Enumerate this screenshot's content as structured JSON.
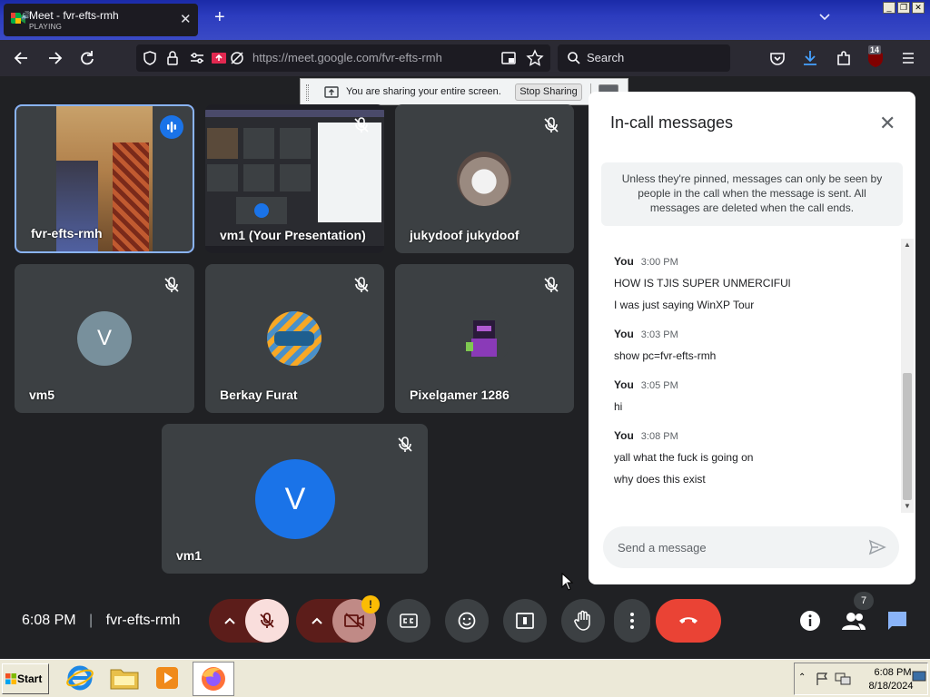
{
  "browser": {
    "tab_title": "Meet - fvr-efts-rmh",
    "tab_subtitle": "PLAYING",
    "url": "https://meet.google.com/fvr-efts-rmh",
    "search_placeholder": "Search",
    "extension_badge": "14"
  },
  "share_banner": {
    "text": "You are sharing your entire screen.",
    "stop_label": "Stop Sharing"
  },
  "participants": [
    {
      "name": "fvr-efts-rmh"
    },
    {
      "name": "vm1 (Your Presentation)"
    },
    {
      "name": "jukydoof jukydoof"
    },
    {
      "name": "vm5",
      "initial": "V"
    },
    {
      "name": "Berkay Furat"
    },
    {
      "name": "Pixelgamer 1286"
    },
    {
      "name": "vm1",
      "initial": "V"
    }
  ],
  "chat": {
    "title": "In-call messages",
    "notice": "Unless they're pinned, messages can only be seen by people in the call when the message is sent. All messages are deleted when the call ends.",
    "messages": [
      {
        "sender": "You",
        "time": "3:00 PM",
        "lines": [
          "HOW IS TJIS SUPER UNMERCIFUl",
          "I was just saying WinXP Tour"
        ]
      },
      {
        "sender": "You",
        "time": "3:03 PM",
        "lines": [
          "show pc=fvr-efts-rmh"
        ]
      },
      {
        "sender": "You",
        "time": "3:05 PM",
        "lines": [
          "hi"
        ]
      },
      {
        "sender": "You",
        "time": "3:08 PM",
        "lines": [
          "yall what the fuck is going on",
          "why does this exist"
        ]
      }
    ],
    "input_placeholder": "Send a message"
  },
  "meeting": {
    "time": "6:08 PM",
    "code": "fvr-efts-rmh",
    "participant_count": "7",
    "camera_warning": "!"
  },
  "taskbar": {
    "start_label": "Start",
    "time": "6:08 PM",
    "date": "8/18/2024"
  },
  "colors": {
    "meet_bg": "#202124",
    "tile_bg": "#3c4043",
    "accent_blue": "#8ab4f8",
    "end_call_red": "#ea4335",
    "muted_btn_bg": "#f9dedc",
    "avatar_blue": "#1a73e8",
    "avatar_grey": "#78909c"
  }
}
